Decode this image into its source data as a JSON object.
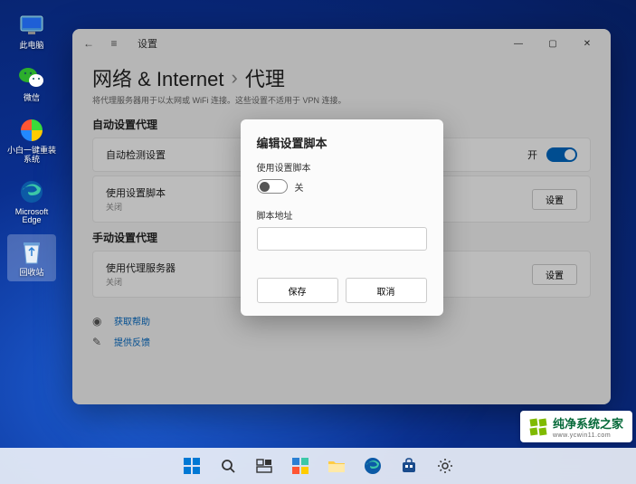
{
  "desktop": {
    "icons": [
      {
        "label": "此电脑",
        "name": "this-pc"
      },
      {
        "label": "微信",
        "name": "wechat"
      },
      {
        "label": "小白一键重装系统",
        "name": "xiaobai-reinstall"
      },
      {
        "label": "Microsoft Edge",
        "name": "edge"
      },
      {
        "label": "回收站",
        "name": "recycle-bin"
      }
    ]
  },
  "settings": {
    "app_title": "设置",
    "breadcrumb": {
      "root": "网络 & Internet",
      "sep": "›",
      "page": "代理"
    },
    "description": "将代理服务器用于以太网或 WiFi 连接。这些设置不适用于 VPN 连接。",
    "sections": {
      "auto": {
        "title": "自动设置代理",
        "detect": {
          "title": "自动检测设置",
          "state_label": "开"
        },
        "script": {
          "title": "使用设置脚本",
          "sub": "关闭",
          "button": "设置"
        }
      },
      "manual": {
        "title": "手动设置代理",
        "proxy": {
          "title": "使用代理服务器",
          "sub": "关闭",
          "button": "设置"
        }
      }
    },
    "links": {
      "help": "获取帮助",
      "feedback": "提供反馈"
    },
    "window_controls": {
      "min": "—",
      "max": "▢",
      "close": "✕"
    }
  },
  "modal": {
    "title": "编辑设置脚本",
    "toggle_label": "使用设置脚本",
    "toggle_state": "关",
    "address_label": "脚本地址",
    "address_value": "",
    "save": "保存",
    "cancel": "取消"
  },
  "taskbar": {
    "items": [
      "start",
      "search",
      "task-view",
      "widgets",
      "file-explorer",
      "edge",
      "store",
      "settings"
    ]
  },
  "watermark": {
    "brand": "纯净系统之家",
    "url": "www.ycwin11.com"
  }
}
